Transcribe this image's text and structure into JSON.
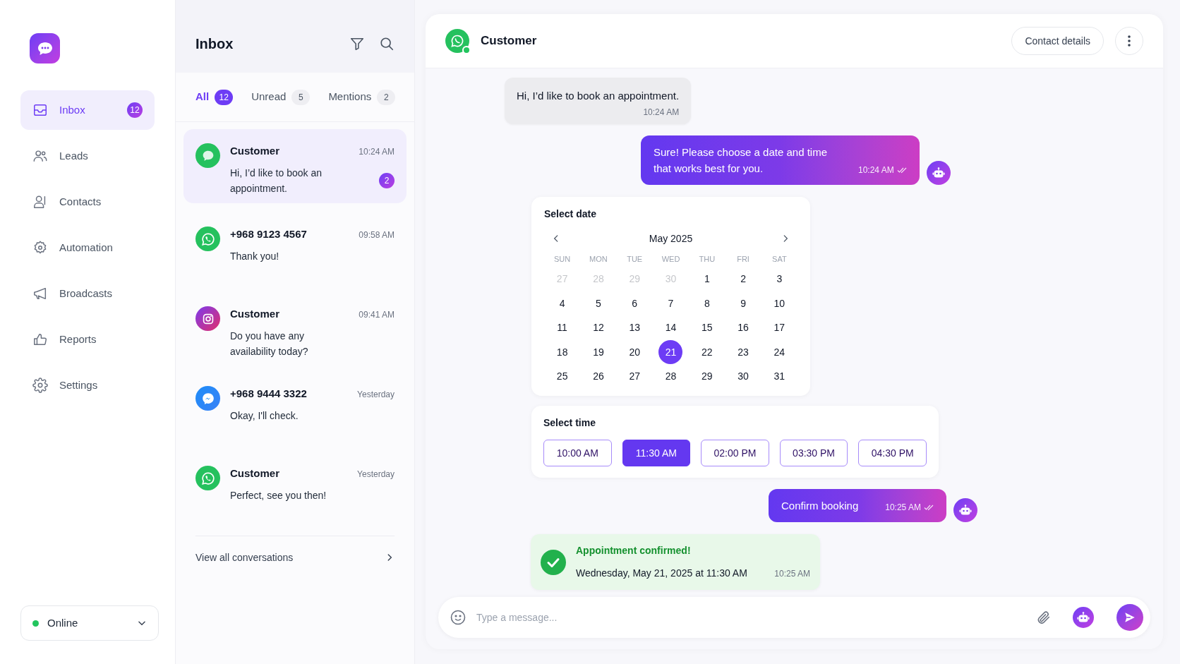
{
  "sidebar": {
    "items": [
      {
        "label": "Inbox",
        "kind": "inbox",
        "selected": true,
        "badge": "12"
      },
      {
        "label": "Leads",
        "kind": "users",
        "selected": false
      },
      {
        "label": "Contacts",
        "kind": "contacts",
        "selected": false
      },
      {
        "label": "Automation",
        "kind": "automation",
        "selected": false
      },
      {
        "label": "Broadcasts",
        "kind": "megaphone",
        "selected": false
      },
      {
        "label": "Reports",
        "kind": "thumb",
        "selected": false
      },
      {
        "label": "Settings",
        "kind": "settings",
        "selected": false
      }
    ],
    "status": {
      "label": "Online",
      "color": "#22c55e"
    }
  },
  "inbox": {
    "title": "Inbox",
    "tabs": [
      {
        "label": "All",
        "count": "12",
        "selected": true
      },
      {
        "label": "Unread",
        "count": "5",
        "selected": false
      },
      {
        "label": "Mentions",
        "count": "2",
        "selected": false
      }
    ],
    "conversations": [
      {
        "name": "Customer",
        "time": "10:24 AM",
        "preview": "Hi, I’d like to book an appointment.",
        "kind": "chat",
        "unread": "2",
        "selected": true
      },
      {
        "name": "+968 9123 4567",
        "time": "09:58 AM",
        "preview": "Thank you!",
        "kind": "whatsapp",
        "selected": false
      },
      {
        "name": "Customer",
        "time": "09:41 AM",
        "preview": "Do you have any availability today?",
        "kind": "instagram",
        "selected": false
      },
      {
        "name": "+968 9444 3322",
        "time": "Yesterday",
        "preview": "Okay, I'll check.",
        "kind": "messenger",
        "selected": false
      },
      {
        "name": "Customer",
        "time": "Yesterday",
        "preview": "Perfect, see you then!",
        "kind": "whatsapp",
        "selected": false
      }
    ],
    "view_all": "View all conversations"
  },
  "chat": {
    "contact": "Customer",
    "contact_details_button": "Contact details",
    "messages": [
      {
        "kind": "incoming",
        "text": "Hi, I’d like to book an appointment.",
        "time": "10:24 AM"
      },
      {
        "kind": "outgoing",
        "text": "Sure! Please choose a date and time that works best for you.",
        "time": "10:24 AM",
        "read": true
      },
      {
        "kind": "date_picker",
        "title": "Select date",
        "month": "May 2025",
        "weekdays": [
          "SUN",
          "MON",
          "TUE",
          "WED",
          "THU",
          "FRI",
          "SAT"
        ],
        "days": [
          {
            "label": "27",
            "muted": true,
            "selected": false
          },
          {
            "label": "28",
            "muted": true,
            "selected": false
          },
          {
            "label": "29",
            "muted": true,
            "selected": false
          },
          {
            "label": "30",
            "muted": true,
            "selected": false
          },
          {
            "label": "1",
            "muted": false,
            "selected": false
          },
          {
            "label": "2",
            "muted": false,
            "selected": false
          },
          {
            "label": "3",
            "muted": false,
            "selected": false
          },
          {
            "label": "4",
            "muted": false,
            "selected": false
          },
          {
            "label": "5",
            "muted": false,
            "selected": false
          },
          {
            "label": "6",
            "muted": false,
            "selected": false
          },
          {
            "label": "7",
            "muted": false,
            "selected": false
          },
          {
            "label": "8",
            "muted": false,
            "selected": false
          },
          {
            "label": "9",
            "muted": false,
            "selected": false
          },
          {
            "label": "10",
            "muted": false,
            "selected": false
          },
          {
            "label": "11",
            "muted": false,
            "selected": false
          },
          {
            "label": "12",
            "muted": false,
            "selected": false
          },
          {
            "label": "13",
            "muted": false,
            "selected": false
          },
          {
            "label": "14",
            "muted": false,
            "selected": false
          },
          {
            "label": "15",
            "muted": false,
            "selected": false
          },
          {
            "label": "16",
            "muted": false,
            "selected": false
          },
          {
            "label": "17",
            "muted": false,
            "selected": false
          },
          {
            "label": "18",
            "muted": false,
            "selected": false
          },
          {
            "label": "19",
            "muted": false,
            "selected": false
          },
          {
            "label": "20",
            "muted": false,
            "selected": false
          },
          {
            "label": "21",
            "muted": false,
            "selected": true
          },
          {
            "label": "22",
            "muted": false,
            "selected": false
          },
          {
            "label": "23",
            "muted": false,
            "selected": false
          },
          {
            "label": "24",
            "muted": false,
            "selected": false
          },
          {
            "label": "25",
            "muted": false,
            "selected": false
          },
          {
            "label": "26",
            "muted": false,
            "selected": false
          },
          {
            "label": "27",
            "muted": false,
            "selected": false
          },
          {
            "label": "28",
            "muted": false,
            "selected": false
          },
          {
            "label": "29",
            "muted": false,
            "selected": false
          },
          {
            "label": "30",
            "muted": false,
            "selected": false
          },
          {
            "label": "31",
            "muted": false,
            "selected": false
          }
        ]
      },
      {
        "kind": "time_picker",
        "title": "Select time",
        "slots": [
          {
            "label": "10:00 AM",
            "selected": false
          },
          {
            "label": "11:30 AM",
            "selected": true
          },
          {
            "label": "02:00 PM",
            "selected": false
          },
          {
            "label": "03:30 PM",
            "selected": false
          },
          {
            "label": "04:30 PM",
            "selected": false
          }
        ]
      },
      {
        "kind": "outgoing",
        "text": "Confirm booking",
        "time": "10:25 AM",
        "read": true
      },
      {
        "kind": "confirmation",
        "title": "Appointment confirmed!",
        "text": "Wednesday, May 21, 2025 at 11:30 AM",
        "time": "10:25 AM"
      }
    ],
    "composer": {
      "placeholder": "Type a message..."
    }
  }
}
